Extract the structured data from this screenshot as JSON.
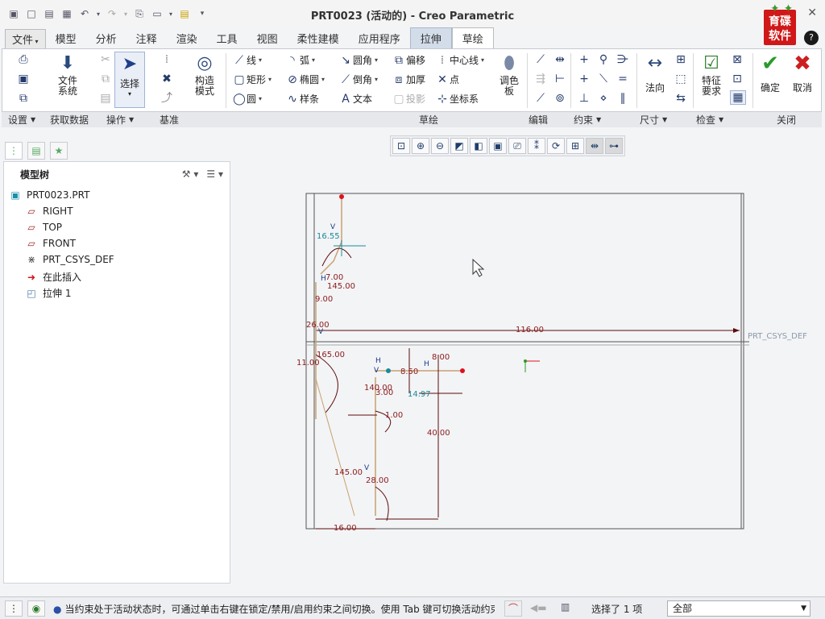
{
  "window": {
    "title": "PRT0023 (活动的) - Creo Parametric",
    "logo_line1": "育碟",
    "logo_line2": "软件"
  },
  "ribbon_tabs": [
    {
      "label": "文件",
      "kind": "file"
    },
    {
      "label": "模型",
      "kind": "normal"
    },
    {
      "label": "分析",
      "kind": "normal"
    },
    {
      "label": "注释",
      "kind": "normal"
    },
    {
      "label": "渲染",
      "kind": "normal"
    },
    {
      "label": "工具",
      "kind": "normal"
    },
    {
      "label": "视图",
      "kind": "normal"
    },
    {
      "label": "柔性建模",
      "kind": "normal"
    },
    {
      "label": "应用程序",
      "kind": "normal"
    },
    {
      "label": "拉伸",
      "kind": "lashen"
    },
    {
      "label": "草绘",
      "kind": "active"
    }
  ],
  "ribbon": {
    "file_system": "文件\n系统",
    "select": "选择",
    "construct_mode": "构造\n模式",
    "line": "线",
    "rectangle": "矩形",
    "circle": "圆",
    "arc": "弧",
    "ellipse": "椭圆",
    "spline": "样条",
    "fillet": "圆角",
    "chamfer": "倒角",
    "text": "文本",
    "offset": "偏移",
    "thicken": "加厚",
    "project": "投影",
    "centerline": "中心线",
    "point": "点",
    "coord_sys": "坐标系",
    "palette": "调色\n板",
    "normal_dim": "法向",
    "feature_req": "特征\n要求",
    "ok": "确定",
    "cancel": "取消"
  },
  "groups": [
    {
      "label": "设置",
      "dropdown": true,
      "width": 52
    },
    {
      "label": "获取数据",
      "dropdown": false,
      "width": 70
    },
    {
      "label": "操作",
      "dropdown": true,
      "width": 66
    },
    {
      "label": "基准",
      "dropdown": false,
      "width": 226
    },
    {
      "label": "草绘",
      "dropdown": false,
      "width": 232
    },
    {
      "label": "编辑",
      "dropdown": false,
      "width": 56
    },
    {
      "label": "约束",
      "dropdown": true,
      "width": 82
    },
    {
      "label": "尺寸",
      "dropdown": true,
      "width": 70
    },
    {
      "label": "检查",
      "dropdown": true,
      "width": 86
    },
    {
      "label": "关闭",
      "dropdown": false,
      "width": 68
    }
  ],
  "tree": {
    "header": "模型树",
    "items": [
      {
        "label": "PRT0023.PRT",
        "icon": "part-icon"
      },
      {
        "label": "RIGHT",
        "icon": "datum-plane-icon"
      },
      {
        "label": "TOP",
        "icon": "datum-plane-icon"
      },
      {
        "label": "FRONT",
        "icon": "datum-plane-icon"
      },
      {
        "label": "PRT_CSYS_DEF",
        "icon": "csys-icon"
      },
      {
        "label": "在此插入",
        "icon": "insert-arrow-icon"
      },
      {
        "label": "拉伸 1",
        "icon": "extrude-icon"
      }
    ]
  },
  "sketch": {
    "dims": [
      "16.55",
      "7.00",
      "145.00",
      "9.00",
      "26.00",
      "116.00",
      "11.00",
      "165.00",
      "8.00",
      "8.50",
      "140.00",
      "3.00",
      "14.97",
      "1.00",
      "40.00",
      "145.00",
      "28.00",
      "16.00"
    ],
    "csys_label": "PRT_CSYS_DEF",
    "constraint_labels": [
      "V",
      "H",
      "V",
      "H",
      "V",
      "H",
      "V"
    ]
  },
  "status": {
    "message": "当约束处于活动状态时，可通过单击右键在锁定/禁用/启用约束之间切换。使用 Tab 键可切换活动约束。按住",
    "selected": "选择了 1 项",
    "filter": "全部"
  },
  "colors": {
    "accent": "#2a4fa8",
    "sketch_line": "#c8a070",
    "dim_text": "#8a1a1a",
    "dim_line": "#5b0b0b",
    "sketch_blue": "#1a8a9a",
    "close_red": "#cc1f1f",
    "ok_green": "#2b9a2b"
  }
}
